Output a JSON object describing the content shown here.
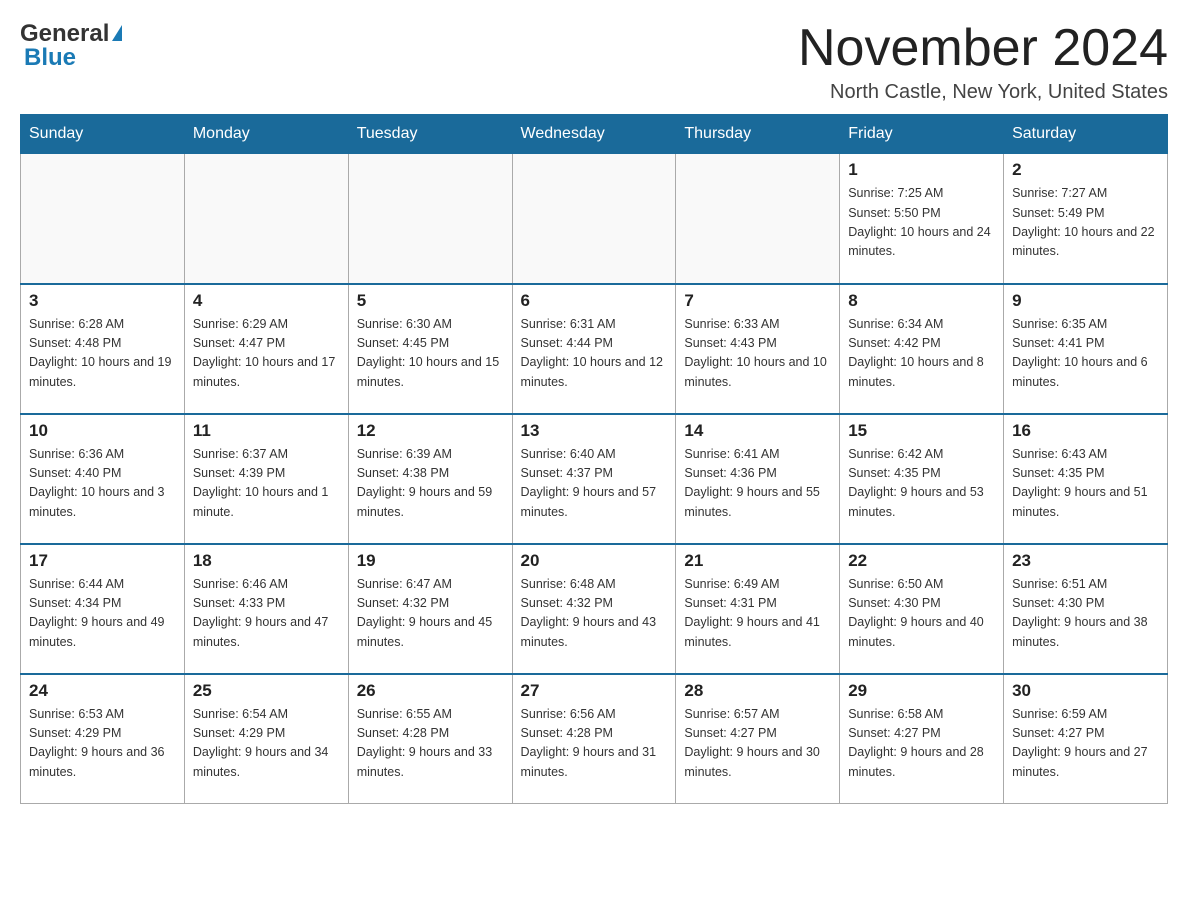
{
  "header": {
    "logo_general": "General",
    "logo_blue": "Blue",
    "month_title": "November 2024",
    "location": "North Castle, New York, United States"
  },
  "days_of_week": [
    "Sunday",
    "Monday",
    "Tuesday",
    "Wednesday",
    "Thursday",
    "Friday",
    "Saturday"
  ],
  "weeks": [
    [
      {
        "day": "",
        "info": ""
      },
      {
        "day": "",
        "info": ""
      },
      {
        "day": "",
        "info": ""
      },
      {
        "day": "",
        "info": ""
      },
      {
        "day": "",
        "info": ""
      },
      {
        "day": "1",
        "info": "Sunrise: 7:25 AM\nSunset: 5:50 PM\nDaylight: 10 hours and 24 minutes."
      },
      {
        "day": "2",
        "info": "Sunrise: 7:27 AM\nSunset: 5:49 PM\nDaylight: 10 hours and 22 minutes."
      }
    ],
    [
      {
        "day": "3",
        "info": "Sunrise: 6:28 AM\nSunset: 4:48 PM\nDaylight: 10 hours and 19 minutes."
      },
      {
        "day": "4",
        "info": "Sunrise: 6:29 AM\nSunset: 4:47 PM\nDaylight: 10 hours and 17 minutes."
      },
      {
        "day": "5",
        "info": "Sunrise: 6:30 AM\nSunset: 4:45 PM\nDaylight: 10 hours and 15 minutes."
      },
      {
        "day": "6",
        "info": "Sunrise: 6:31 AM\nSunset: 4:44 PM\nDaylight: 10 hours and 12 minutes."
      },
      {
        "day": "7",
        "info": "Sunrise: 6:33 AM\nSunset: 4:43 PM\nDaylight: 10 hours and 10 minutes."
      },
      {
        "day": "8",
        "info": "Sunrise: 6:34 AM\nSunset: 4:42 PM\nDaylight: 10 hours and 8 minutes."
      },
      {
        "day": "9",
        "info": "Sunrise: 6:35 AM\nSunset: 4:41 PM\nDaylight: 10 hours and 6 minutes."
      }
    ],
    [
      {
        "day": "10",
        "info": "Sunrise: 6:36 AM\nSunset: 4:40 PM\nDaylight: 10 hours and 3 minutes."
      },
      {
        "day": "11",
        "info": "Sunrise: 6:37 AM\nSunset: 4:39 PM\nDaylight: 10 hours and 1 minute."
      },
      {
        "day": "12",
        "info": "Sunrise: 6:39 AM\nSunset: 4:38 PM\nDaylight: 9 hours and 59 minutes."
      },
      {
        "day": "13",
        "info": "Sunrise: 6:40 AM\nSunset: 4:37 PM\nDaylight: 9 hours and 57 minutes."
      },
      {
        "day": "14",
        "info": "Sunrise: 6:41 AM\nSunset: 4:36 PM\nDaylight: 9 hours and 55 minutes."
      },
      {
        "day": "15",
        "info": "Sunrise: 6:42 AM\nSunset: 4:35 PM\nDaylight: 9 hours and 53 minutes."
      },
      {
        "day": "16",
        "info": "Sunrise: 6:43 AM\nSunset: 4:35 PM\nDaylight: 9 hours and 51 minutes."
      }
    ],
    [
      {
        "day": "17",
        "info": "Sunrise: 6:44 AM\nSunset: 4:34 PM\nDaylight: 9 hours and 49 minutes."
      },
      {
        "day": "18",
        "info": "Sunrise: 6:46 AM\nSunset: 4:33 PM\nDaylight: 9 hours and 47 minutes."
      },
      {
        "day": "19",
        "info": "Sunrise: 6:47 AM\nSunset: 4:32 PM\nDaylight: 9 hours and 45 minutes."
      },
      {
        "day": "20",
        "info": "Sunrise: 6:48 AM\nSunset: 4:32 PM\nDaylight: 9 hours and 43 minutes."
      },
      {
        "day": "21",
        "info": "Sunrise: 6:49 AM\nSunset: 4:31 PM\nDaylight: 9 hours and 41 minutes."
      },
      {
        "day": "22",
        "info": "Sunrise: 6:50 AM\nSunset: 4:30 PM\nDaylight: 9 hours and 40 minutes."
      },
      {
        "day": "23",
        "info": "Sunrise: 6:51 AM\nSunset: 4:30 PM\nDaylight: 9 hours and 38 minutes."
      }
    ],
    [
      {
        "day": "24",
        "info": "Sunrise: 6:53 AM\nSunset: 4:29 PM\nDaylight: 9 hours and 36 minutes."
      },
      {
        "day": "25",
        "info": "Sunrise: 6:54 AM\nSunset: 4:29 PM\nDaylight: 9 hours and 34 minutes."
      },
      {
        "day": "26",
        "info": "Sunrise: 6:55 AM\nSunset: 4:28 PM\nDaylight: 9 hours and 33 minutes."
      },
      {
        "day": "27",
        "info": "Sunrise: 6:56 AM\nSunset: 4:28 PM\nDaylight: 9 hours and 31 minutes."
      },
      {
        "day": "28",
        "info": "Sunrise: 6:57 AM\nSunset: 4:27 PM\nDaylight: 9 hours and 30 minutes."
      },
      {
        "day": "29",
        "info": "Sunrise: 6:58 AM\nSunset: 4:27 PM\nDaylight: 9 hours and 28 minutes."
      },
      {
        "day": "30",
        "info": "Sunrise: 6:59 AM\nSunset: 4:27 PM\nDaylight: 9 hours and 27 minutes."
      }
    ]
  ]
}
